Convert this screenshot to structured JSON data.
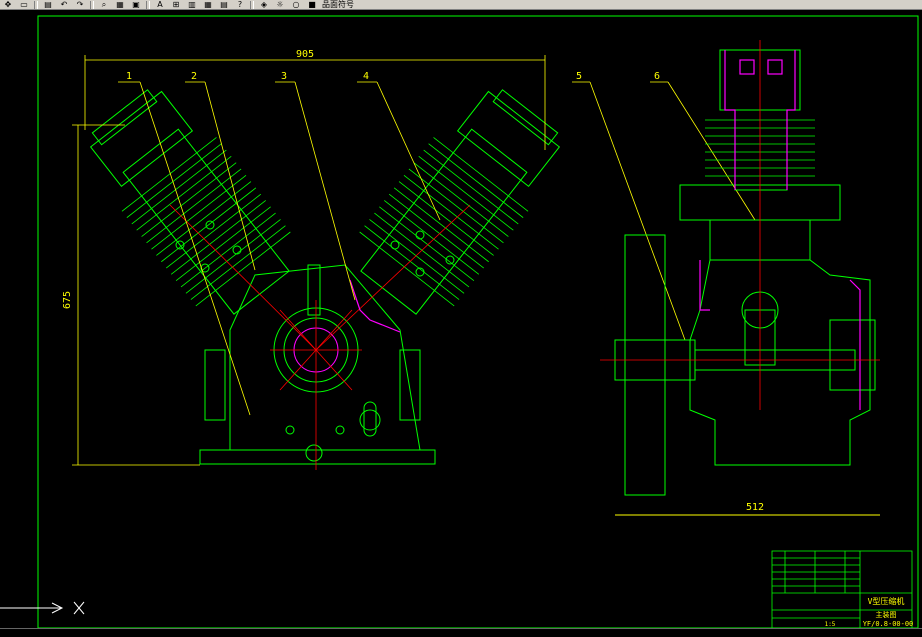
{
  "toolbar": {
    "icons": [
      "pan-icon",
      "open-icon",
      "print-icon",
      "undo-icon",
      "redo-icon",
      "zoom-window-icon",
      "properties-icon",
      "layer-icon",
      "text-style-icon",
      "dim-style-icon",
      "block-icon",
      "calculator-icon",
      "table-icon",
      "help-icon",
      "layers-manager-icon",
      "sun-icon",
      "bulb-icon",
      "color-icon"
    ],
    "text_a": "A",
    "layer_label": "品面符号"
  },
  "drawing": {
    "dim_width_front": "905",
    "dim_height_front": "675",
    "dim_width_side": "512",
    "balloons": [
      "1",
      "2",
      "3",
      "4",
      "5",
      "6"
    ],
    "colors": {
      "body": "#00ff00",
      "center": "#ff0000",
      "dim": "#ffff00",
      "section": "#ff00ff",
      "hidden": "#00ffff",
      "frame": "#00ff00"
    }
  },
  "title_block": {
    "title": "主装图",
    "drawing_no": "YF/0.8-00-00",
    "sub_title": "V型压缩机",
    "scale": "1:5"
  }
}
